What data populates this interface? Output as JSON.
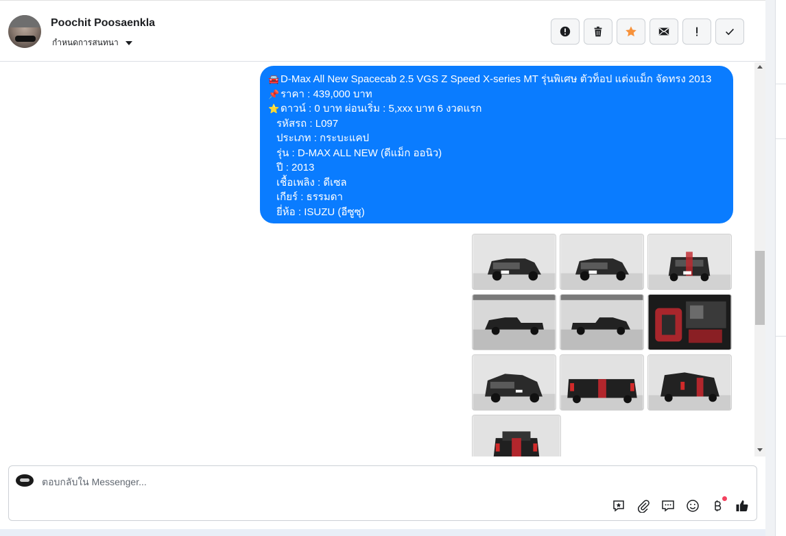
{
  "header": {
    "contact_name": "Poochit Poosaenkla",
    "conversation_settings_label": "กำหนดการสนทนา",
    "actions": [
      {
        "name": "report-icon",
        "label": "!"
      },
      {
        "name": "trash-icon",
        "label": ""
      },
      {
        "name": "star-icon",
        "label": ""
      },
      {
        "name": "mail-icon",
        "label": ""
      },
      {
        "name": "exclamation-icon",
        "label": "!"
      },
      {
        "name": "check-icon",
        "label": ""
      }
    ],
    "star_color": "#f7923b"
  },
  "message": {
    "line1": "D-Max All New Spacecab 2.5 VGS Z Speed X-series MT รุ่นพิเศษ ตัวท็อป แต่งแม็ก จัดทรง 2013",
    "line1_icon": "car-icon",
    "line2": "ราคา : 439,000 บาท",
    "line2_icon": "pin-icon",
    "line3": "ดาวน์ : 0 บาท ผ่อนเริ่ม : 5,xxx บาท 6 งวดแรก",
    "line3_icon": "star-icon",
    "line4": "รหัสรถ : L097",
    "line5": "ประเภท : กระบะแคป",
    "line6": "รุ่น : D-MAX ALL NEW (ดีแม็ก ออนิว)",
    "line7": "ปี : 2013",
    "line8": "เชื้อเพลิง : ดีเซล",
    "line9": "เกียร์ : ธรรมดา",
    "line10": "ยี่ห้อ : ISUZU (อีซูซุ)",
    "bubble_color": "#0a7cff"
  },
  "photos": {
    "count": 10,
    "items": [
      "car-front-photo",
      "car-front-photo",
      "car-front-photo",
      "car-side-photo",
      "car-side-photo",
      "car-interior-photo",
      "car-front-angle-photo",
      "car-rear-photo",
      "car-rear-angle-photo",
      "car-rear-photo"
    ]
  },
  "composer": {
    "placeholder": "ตอบกลับใน Messenger...",
    "tools": [
      "saved-reply-icon",
      "attachment-icon",
      "chat-bubble-icon",
      "emoji-icon",
      "baht-payment-icon",
      "thumbs-up-icon"
    ]
  }
}
